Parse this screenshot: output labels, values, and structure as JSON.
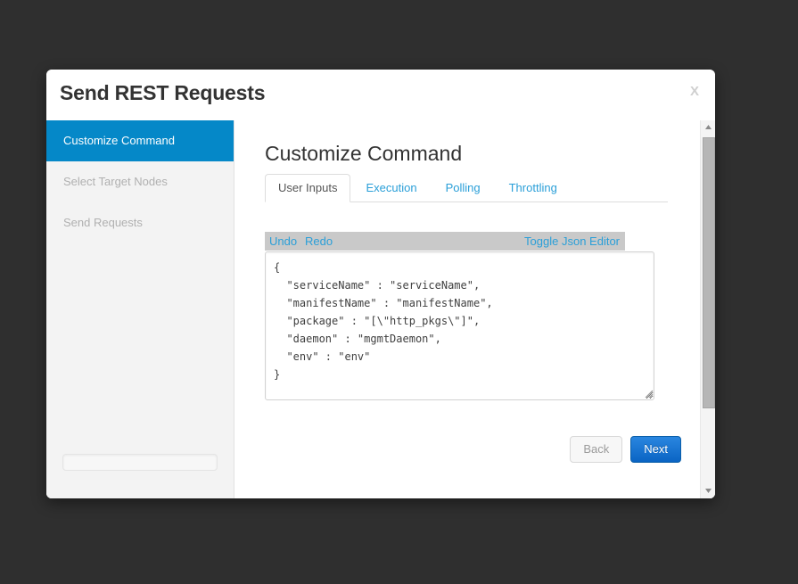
{
  "dialog": {
    "title": "Send REST Requests",
    "close_label": "X"
  },
  "sidebar": {
    "steps": [
      {
        "label": "Customize Command",
        "active": true
      },
      {
        "label": "Select Target Nodes",
        "active": false
      },
      {
        "label": "Send Requests",
        "active": false
      }
    ]
  },
  "main": {
    "heading": "Customize Command",
    "tabs": [
      {
        "label": "User Inputs",
        "active": true
      },
      {
        "label": "Execution",
        "active": false
      },
      {
        "label": "Polling",
        "active": false
      },
      {
        "label": "Throttling",
        "active": false
      }
    ],
    "editor": {
      "undo_label": "Undo",
      "redo_label": "Redo",
      "toggle_label": "Toggle Json Editor",
      "json_value": "{\n  \"serviceName\" : \"serviceName\",\n  \"manifestName\" : \"manifestName\",\n  \"package\" : \"[\\\"http_pkgs\\\"]\",\n  \"daemon\" : \"mgmtDaemon\",\n  \"env\" : \"env\"\n}"
    }
  },
  "footer": {
    "back_label": "Back",
    "next_label": "Next"
  },
  "colors": {
    "accent_blue": "#0588c8",
    "link_blue": "#2a9fd8",
    "next_button_blue": "#0a64c4",
    "toolbar_gray": "#c9c9c9",
    "page_backdrop": "#2f2f2f"
  }
}
